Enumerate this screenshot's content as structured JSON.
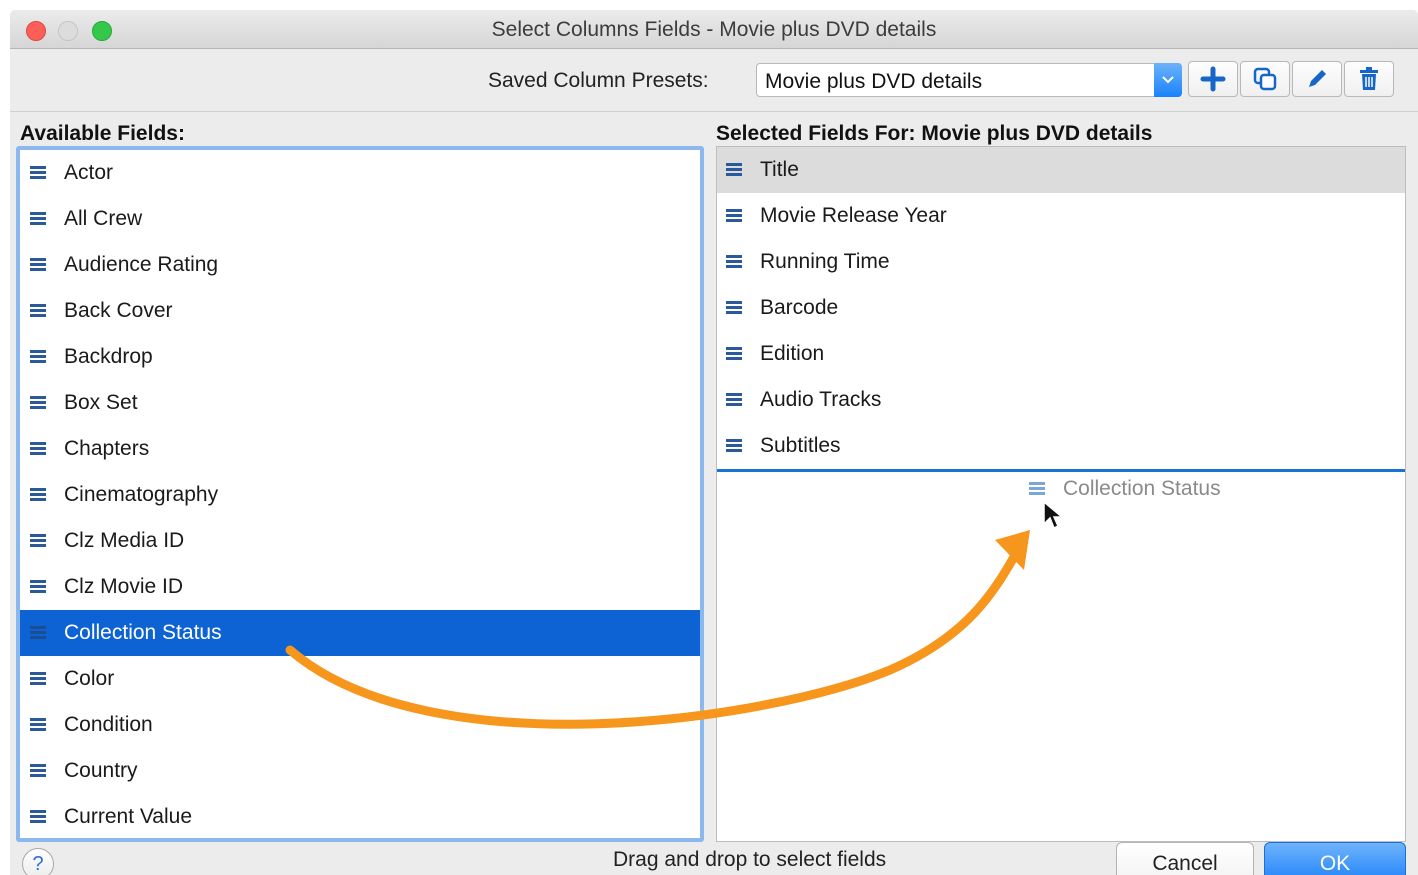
{
  "window": {
    "title": "Select Columns Fields - Movie plus DVD details"
  },
  "toolbar": {
    "preset_label": "Saved Column Presets:",
    "preset_value": "Movie plus DVD details",
    "icons": [
      "add-icon",
      "duplicate-icon",
      "edit-icon",
      "trash-icon"
    ]
  },
  "available": {
    "label": "Available Fields:",
    "items": [
      "Actor",
      "All Crew",
      "Audience Rating",
      "Back Cover",
      "Backdrop",
      "Box Set",
      "Chapters",
      "Cinematography",
      "Clz Media ID",
      "Clz Movie ID",
      "Collection Status",
      "Color",
      "Condition",
      "Country",
      "Current Value"
    ],
    "selected": "Collection Status"
  },
  "selected_fields": {
    "label": "Selected Fields For:  Movie plus DVD details",
    "items": [
      "Title",
      "Movie Release Year",
      "Running Time",
      "Barcode",
      "Edition",
      "Audio Tracks",
      "Subtitles"
    ],
    "highlighted": "Title"
  },
  "drag": {
    "ghost_label": "Collection Status"
  },
  "footer": {
    "hint": "Drag and drop to select fields",
    "help": "?",
    "cancel": "Cancel",
    "ok": "OK"
  },
  "colors": {
    "selection": "#0e63d4",
    "accent_arrow": "#f7961d",
    "list_focus": "#8bb8ee"
  }
}
